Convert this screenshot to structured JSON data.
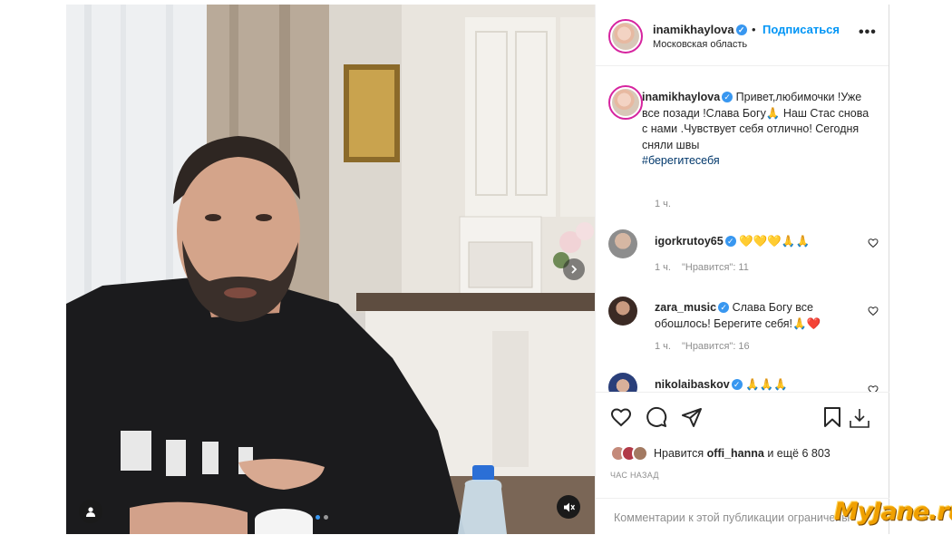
{
  "post": {
    "header": {
      "username": "inamikhaylova",
      "separator": "•",
      "follow_label": "Подписаться",
      "location": "Московская область",
      "more_label": "•••"
    },
    "caption": {
      "username": "inamikhaylova",
      "text": "Привет,любимочки !Уже все позади !Слава Богу🙏 Наш Стас снова с нами .Чувствует себя отлично! Сегодня сняли швы",
      "hashtag": "#берегитесебя",
      "time": "1 ч."
    },
    "comments": [
      {
        "username": "igorkrutoy65",
        "text": "💛💛💛🙏🙏",
        "time": "1 ч.",
        "likes": "\"Нравится\": 11"
      },
      {
        "username": "zara_music",
        "text": "Слава Богу все обошлось! Берегите себя!🙏❤️",
        "time": "1 ч.",
        "likes": "\"Нравится\": 16"
      },
      {
        "username": "nikolaibaskov",
        "text": "🙏🙏🙏"
      }
    ],
    "likes_text_prefix": "Нравится",
    "likes_user": "offi_hanna",
    "likes_text_suffix": "и ещё 6 803",
    "posted_ago": "ЧАС НАЗАД",
    "comment_placeholder": "Комментарии к этой публикации ограничены",
    "verified_mark": "✓"
  },
  "watermark": "MyJane.ru",
  "colors": {
    "accent": "#0095f6",
    "verified": "#3897f0",
    "muted": "#8e8e8e",
    "watermark": "#f0a000"
  }
}
